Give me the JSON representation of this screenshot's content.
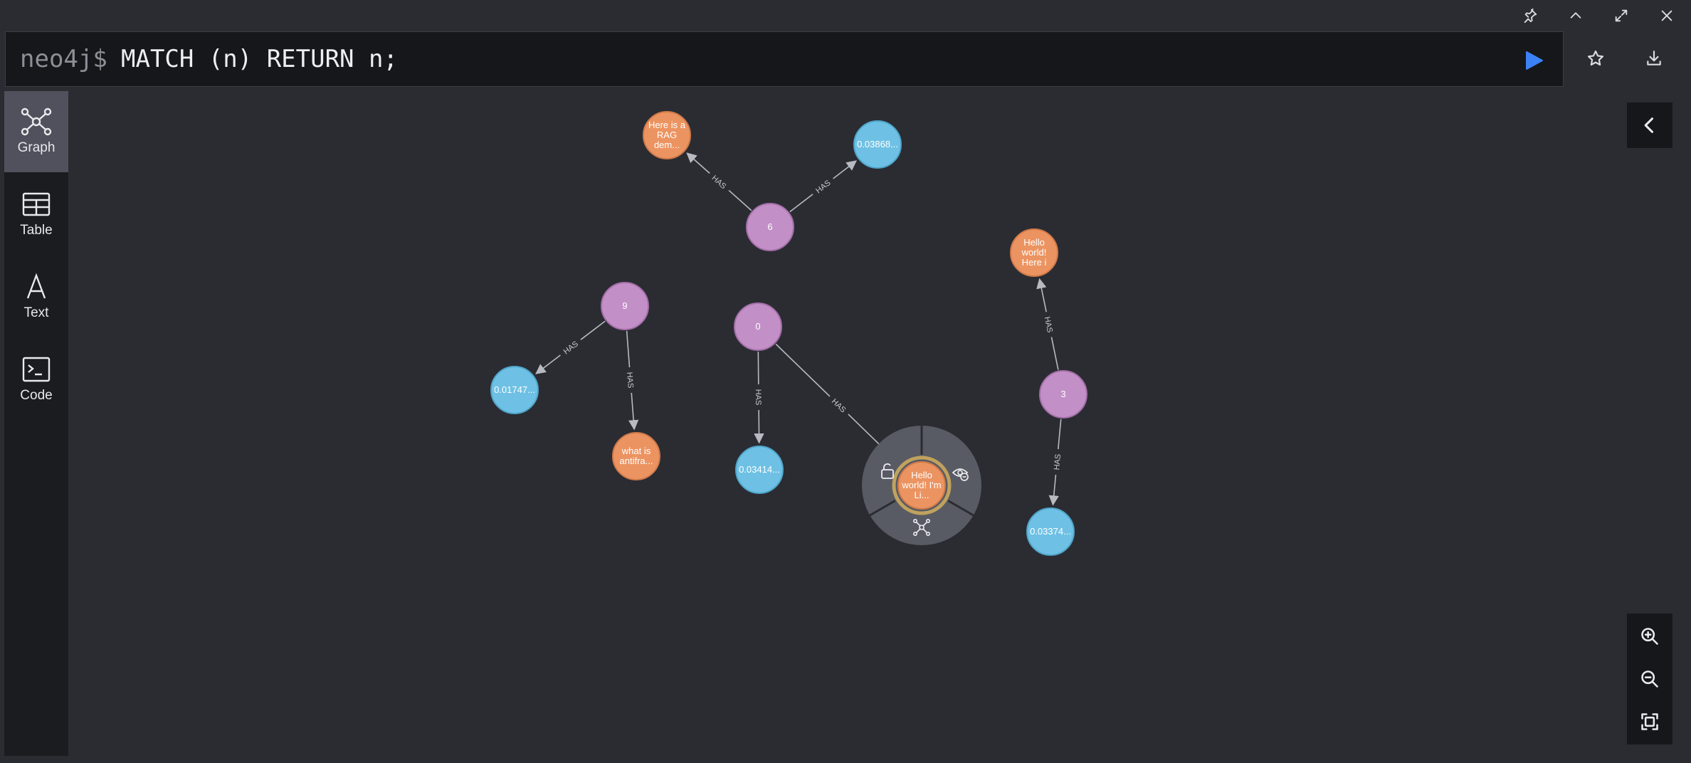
{
  "window_controls": [
    {
      "name": "pin-icon"
    },
    {
      "name": "collapse-icon"
    },
    {
      "name": "fullscreen-icon"
    },
    {
      "name": "close-icon"
    }
  ],
  "editor": {
    "prompt": "neo4j$",
    "query": "MATCH (n) RETURN n;"
  },
  "colors": {
    "run": "#3b82f6",
    "node_purple": "#c28fc6",
    "node_purple_border": "#a46ea8",
    "node_orange": "#ec9461",
    "node_orange_border": "#d07a49",
    "node_blue": "#6ec1e4",
    "node_blue_border": "#4fa4c9",
    "rel": "#b7bac0"
  },
  "views": [
    {
      "label": "Graph",
      "icon": "graph-icon",
      "active": true
    },
    {
      "label": "Table",
      "icon": "table-icon",
      "active": false
    },
    {
      "label": "Text",
      "icon": "text-icon",
      "active": false
    },
    {
      "label": "Code",
      "icon": "code-icon",
      "active": false
    }
  ],
  "graph": {
    "nodes": [
      {
        "id": "n6",
        "lines": [
          "6"
        ],
        "kind": "purple"
      },
      {
        "id": "n9",
        "lines": [
          "9"
        ],
        "kind": "purple"
      },
      {
        "id": "n0",
        "lines": [
          "0"
        ],
        "kind": "purple"
      },
      {
        "id": "n3",
        "lines": [
          "3"
        ],
        "kind": "purple"
      },
      {
        "id": "rag",
        "lines": [
          "Here is a",
          "RAG",
          "dem..."
        ],
        "kind": "orange"
      },
      {
        "id": "v038",
        "lines": [
          "0.03868..."
        ],
        "kind": "blue"
      },
      {
        "id": "hello3",
        "lines": [
          "Hello",
          "world!",
          "Here i"
        ],
        "kind": "orange"
      },
      {
        "id": "v017",
        "lines": [
          "0.01747..."
        ],
        "kind": "blue"
      },
      {
        "id": "antifra",
        "lines": [
          "what is",
          "antifra..."
        ],
        "kind": "orange"
      },
      {
        "id": "v034",
        "lines": [
          "0.03414..."
        ],
        "kind": "blue"
      },
      {
        "id": "hellosel",
        "lines": [
          "Hello",
          "world! I'm",
          "Li..."
        ],
        "kind": "orange"
      },
      {
        "id": "v033",
        "lines": [
          "0.03374..."
        ],
        "kind": "blue"
      }
    ],
    "relationships": [
      {
        "from": "n6",
        "to": "rag",
        "label": "HAS"
      },
      {
        "from": "n6",
        "to": "v038",
        "label": "HAS"
      },
      {
        "from": "n9",
        "to": "v017",
        "label": "HAS"
      },
      {
        "from": "n9",
        "to": "antifra",
        "label": "HAS"
      },
      {
        "from": "n0",
        "to": "v034",
        "label": "HAS"
      },
      {
        "from": "n0",
        "to": "hellosel",
        "label": "HAS"
      },
      {
        "from": "n3",
        "to": "hello3",
        "label": "HAS"
      },
      {
        "from": "n3",
        "to": "v033",
        "label": "HAS"
      }
    ],
    "selected": "hellosel",
    "ring_actions": [
      {
        "name": "unlock-icon"
      },
      {
        "name": "hide-icon"
      },
      {
        "name": "expand-icon"
      }
    ]
  },
  "zoom": [
    {
      "name": "zoom-in-icon"
    },
    {
      "name": "zoom-out-icon"
    },
    {
      "name": "fit-to-screen-icon"
    }
  ]
}
